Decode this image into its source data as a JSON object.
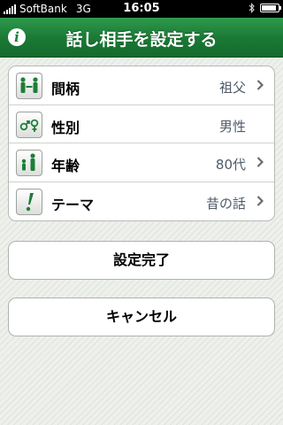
{
  "status_bar": {
    "carrier": "SoftBank",
    "network": "3G",
    "time": "16:05"
  },
  "nav": {
    "title": "話し相手を設定する",
    "info_icon": "info-icon"
  },
  "settings": [
    {
      "label": "間柄",
      "value": "祖父",
      "icon": "family-relation-icon",
      "has_chevron": true
    },
    {
      "label": "性別",
      "value": "男性",
      "icon": "gender-symbols-icon",
      "has_chevron": false
    },
    {
      "label": "年齢",
      "value": "80代",
      "icon": "age-figures-icon",
      "has_chevron": true
    },
    {
      "label": "テーマ",
      "value": "昔の話",
      "icon": "exclamation-icon",
      "has_chevron": true
    }
  ],
  "buttons": {
    "done": "設定完了",
    "cancel": "キャンセル"
  },
  "colors": {
    "accent_green": "#1b7a35",
    "value_text": "#4e5a69"
  }
}
